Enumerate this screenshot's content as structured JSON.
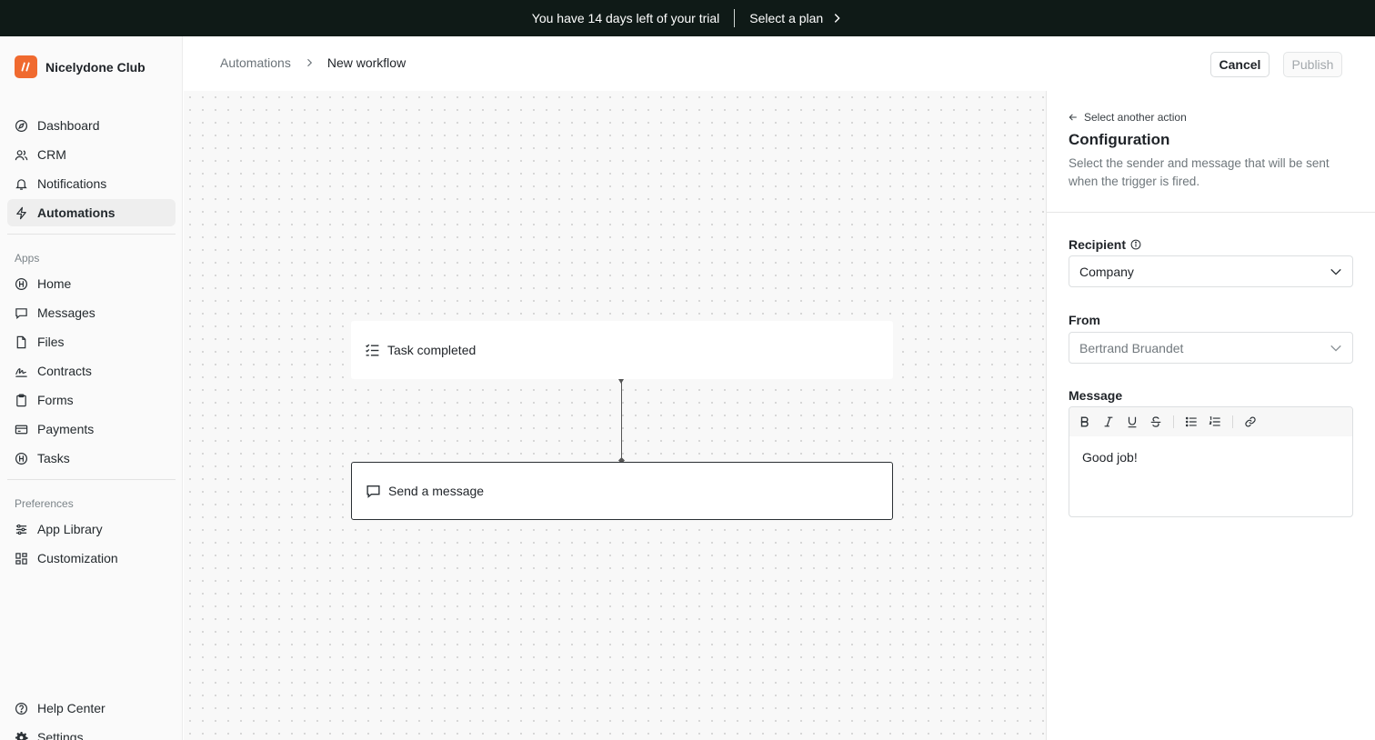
{
  "banner": {
    "text": "You have 14 days left of your trial",
    "cta": "Select a plan"
  },
  "brand": {
    "name": "Nicelydone Club",
    "color": "#f06a2f"
  },
  "nav": {
    "main": [
      {
        "label": "Dashboard",
        "icon": "compass-icon"
      },
      {
        "label": "CRM",
        "icon": "users-icon"
      },
      {
        "label": "Notifications",
        "icon": "bell-icon"
      },
      {
        "label": "Automations",
        "icon": "bolt-icon",
        "active": true
      }
    ],
    "apps_label": "Apps",
    "apps": [
      {
        "label": "Home",
        "icon": "home-app-icon"
      },
      {
        "label": "Messages",
        "icon": "message-icon"
      },
      {
        "label": "Files",
        "icon": "file-icon"
      },
      {
        "label": "Contracts",
        "icon": "signature-icon"
      },
      {
        "label": "Forms",
        "icon": "clipboard-icon"
      },
      {
        "label": "Payments",
        "icon": "credit-card-icon"
      },
      {
        "label": "Tasks",
        "icon": "tasks-icon"
      }
    ],
    "prefs_label": "Preferences",
    "prefs": [
      {
        "label": "App Library",
        "icon": "sliders-icon"
      },
      {
        "label": "Customization",
        "icon": "grid-icon"
      }
    ],
    "bottom": [
      {
        "label": "Help Center",
        "icon": "help-icon"
      },
      {
        "label": "Settings",
        "icon": "gear-icon"
      }
    ]
  },
  "header": {
    "breadcrumb": [
      "Automations",
      "New workflow"
    ],
    "cancel_label": "Cancel",
    "publish_label": "Publish"
  },
  "workflow": {
    "trigger_label": "Task completed",
    "action_label": "Send a message"
  },
  "panel": {
    "back_label": "Select another action",
    "title": "Configuration",
    "description": "Select the sender and message that will be sent when the trigger is fired.",
    "recipient_label": "Recipient",
    "recipient_value": "Company",
    "from_label": "From",
    "from_value": "Bertrand Bruandet",
    "message_label": "Message",
    "message_value": "Good job!"
  }
}
